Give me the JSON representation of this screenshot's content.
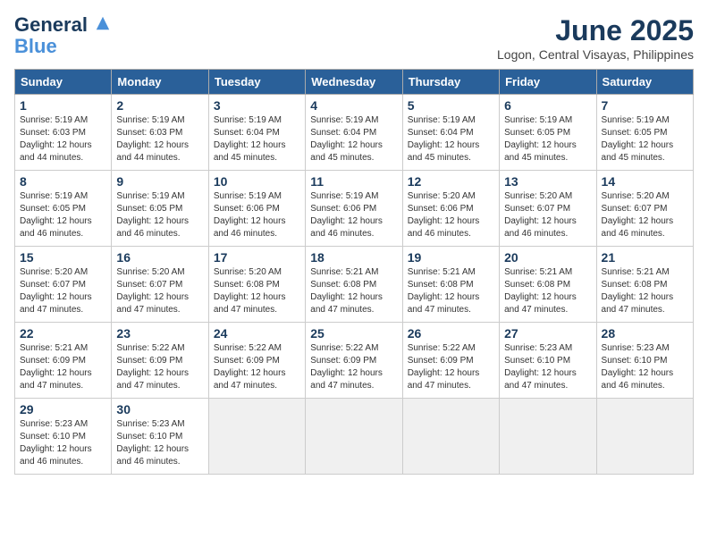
{
  "logo": {
    "line1": "General",
    "line2": "Blue"
  },
  "title": "June 2025",
  "location": "Logon, Central Visayas, Philippines",
  "weekdays": [
    "Sunday",
    "Monday",
    "Tuesday",
    "Wednesday",
    "Thursday",
    "Friday",
    "Saturday"
  ],
  "weeks": [
    [
      {
        "day": 1,
        "rise": "5:19 AM",
        "set": "6:03 PM",
        "light": "12 hours and 44 minutes."
      },
      {
        "day": 2,
        "rise": "5:19 AM",
        "set": "6:03 PM",
        "light": "12 hours and 44 minutes."
      },
      {
        "day": 3,
        "rise": "5:19 AM",
        "set": "6:04 PM",
        "light": "12 hours and 45 minutes."
      },
      {
        "day": 4,
        "rise": "5:19 AM",
        "set": "6:04 PM",
        "light": "12 hours and 45 minutes."
      },
      {
        "day": 5,
        "rise": "5:19 AM",
        "set": "6:04 PM",
        "light": "12 hours and 45 minutes."
      },
      {
        "day": 6,
        "rise": "5:19 AM",
        "set": "6:05 PM",
        "light": "12 hours and 45 minutes."
      },
      {
        "day": 7,
        "rise": "5:19 AM",
        "set": "6:05 PM",
        "light": "12 hours and 45 minutes."
      }
    ],
    [
      {
        "day": 8,
        "rise": "5:19 AM",
        "set": "6:05 PM",
        "light": "12 hours and 46 minutes."
      },
      {
        "day": 9,
        "rise": "5:19 AM",
        "set": "6:05 PM",
        "light": "12 hours and 46 minutes."
      },
      {
        "day": 10,
        "rise": "5:19 AM",
        "set": "6:06 PM",
        "light": "12 hours and 46 minutes."
      },
      {
        "day": 11,
        "rise": "5:19 AM",
        "set": "6:06 PM",
        "light": "12 hours and 46 minutes."
      },
      {
        "day": 12,
        "rise": "5:20 AM",
        "set": "6:06 PM",
        "light": "12 hours and 46 minutes."
      },
      {
        "day": 13,
        "rise": "5:20 AM",
        "set": "6:07 PM",
        "light": "12 hours and 46 minutes."
      },
      {
        "day": 14,
        "rise": "5:20 AM",
        "set": "6:07 PM",
        "light": "12 hours and 46 minutes."
      }
    ],
    [
      {
        "day": 15,
        "rise": "5:20 AM",
        "set": "6:07 PM",
        "light": "12 hours and 47 minutes."
      },
      {
        "day": 16,
        "rise": "5:20 AM",
        "set": "6:07 PM",
        "light": "12 hours and 47 minutes."
      },
      {
        "day": 17,
        "rise": "5:20 AM",
        "set": "6:08 PM",
        "light": "12 hours and 47 minutes."
      },
      {
        "day": 18,
        "rise": "5:21 AM",
        "set": "6:08 PM",
        "light": "12 hours and 47 minutes."
      },
      {
        "day": 19,
        "rise": "5:21 AM",
        "set": "6:08 PM",
        "light": "12 hours and 47 minutes."
      },
      {
        "day": 20,
        "rise": "5:21 AM",
        "set": "6:08 PM",
        "light": "12 hours and 47 minutes."
      },
      {
        "day": 21,
        "rise": "5:21 AM",
        "set": "6:08 PM",
        "light": "12 hours and 47 minutes."
      }
    ],
    [
      {
        "day": 22,
        "rise": "5:21 AM",
        "set": "6:09 PM",
        "light": "12 hours and 47 minutes."
      },
      {
        "day": 23,
        "rise": "5:22 AM",
        "set": "6:09 PM",
        "light": "12 hours and 47 minutes."
      },
      {
        "day": 24,
        "rise": "5:22 AM",
        "set": "6:09 PM",
        "light": "12 hours and 47 minutes."
      },
      {
        "day": 25,
        "rise": "5:22 AM",
        "set": "6:09 PM",
        "light": "12 hours and 47 minutes."
      },
      {
        "day": 26,
        "rise": "5:22 AM",
        "set": "6:09 PM",
        "light": "12 hours and 47 minutes."
      },
      {
        "day": 27,
        "rise": "5:23 AM",
        "set": "6:10 PM",
        "light": "12 hours and 47 minutes."
      },
      {
        "day": 28,
        "rise": "5:23 AM",
        "set": "6:10 PM",
        "light": "12 hours and 46 minutes."
      }
    ],
    [
      {
        "day": 29,
        "rise": "5:23 AM",
        "set": "6:10 PM",
        "light": "12 hours and 46 minutes."
      },
      {
        "day": 30,
        "rise": "5:23 AM",
        "set": "6:10 PM",
        "light": "12 hours and 46 minutes."
      },
      null,
      null,
      null,
      null,
      null
    ]
  ],
  "labels": {
    "sunrise": "Sunrise:",
    "sunset": "Sunset:",
    "daylight": "Daylight:"
  }
}
